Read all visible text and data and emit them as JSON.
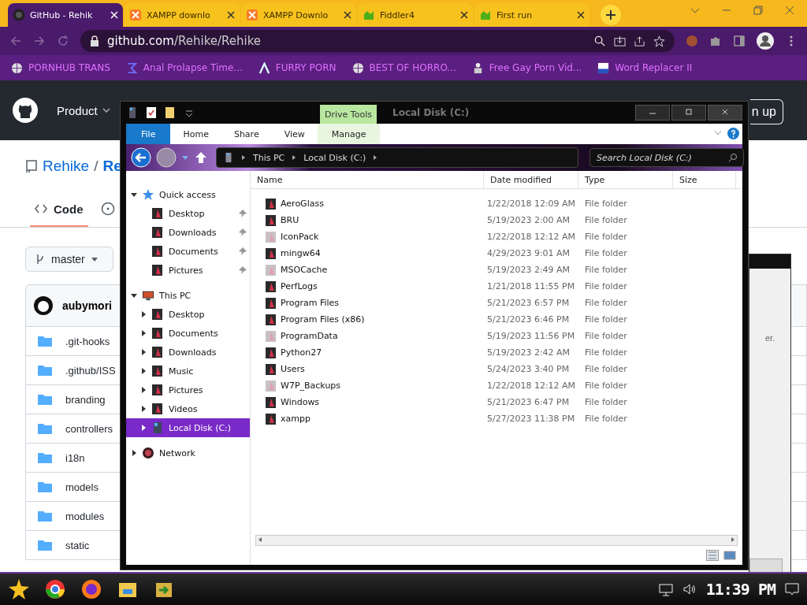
{
  "browser": {
    "tabs": [
      {
        "title": "GitHub - Rehik",
        "selected": true
      },
      {
        "title": "XAMPP downlo",
        "selected": false
      },
      {
        "title": "XAMPP Downlo",
        "selected": false
      },
      {
        "title": "Fiddler4",
        "selected": false
      },
      {
        "title": "First run",
        "selected": false
      }
    ],
    "address": {
      "host": "github.com",
      "path": "/Rehike/Rehike"
    },
    "bookmarks": [
      {
        "label": "PORNHUB TRANS"
      },
      {
        "label": "Anal Prolapse Time..."
      },
      {
        "label": "FURRY PORN"
      },
      {
        "label": "BEST OF HORRO..."
      },
      {
        "label": "Free Gay Porn Vid..."
      },
      {
        "label": "Word Replacer II"
      }
    ]
  },
  "github": {
    "nav_item": "Product",
    "header_button": "n up",
    "repo": {
      "owner": "Rehike",
      "separator": "/",
      "name": "Re"
    },
    "tabs": [
      {
        "label": "Code",
        "selected": true
      }
    ],
    "branch": "master",
    "commit_author": "aubymori",
    "files": [
      ".git-hooks",
      ".github/ISS",
      "branding",
      "controllers",
      "i18n",
      "models",
      "modules",
      "static"
    ]
  },
  "dialog_fragment": {
    "text": "er."
  },
  "explorer": {
    "title": "Local Disk (C:)",
    "contextual_group": "Drive Tools",
    "ribbon_tabs": [
      {
        "label": "File",
        "kind": "file"
      },
      {
        "label": "Home",
        "kind": "tab"
      },
      {
        "label": "Share",
        "kind": "tab"
      },
      {
        "label": "View",
        "kind": "tab"
      },
      {
        "label": "Manage",
        "kind": "contextual"
      }
    ],
    "breadcrumb": [
      "This PC",
      "Local Disk (C:)"
    ],
    "search": {
      "placeholder": "Search Local Disk (C:)"
    },
    "nav_tree": [
      {
        "label": "Quick access",
        "kind": "star",
        "expanded": true,
        "selected": false,
        "children": [
          {
            "label": "Desktop",
            "kind": "folder",
            "pinned": true,
            "selected": false
          },
          {
            "label": "Downloads",
            "kind": "folder",
            "pinned": true,
            "selected": false
          },
          {
            "label": "Documents",
            "kind": "folder",
            "pinned": true,
            "selected": false
          },
          {
            "label": "Pictures",
            "kind": "folder",
            "pinned": true,
            "selected": false
          }
        ]
      },
      {
        "label": "This PC",
        "kind": "pc",
        "expanded": true,
        "selected": false,
        "children": [
          {
            "label": "Desktop",
            "kind": "folder",
            "expanded": false,
            "selected": false
          },
          {
            "label": "Documents",
            "kind": "folder",
            "expanded": false,
            "selected": false
          },
          {
            "label": "Downloads",
            "kind": "folder",
            "expanded": false,
            "selected": false
          },
          {
            "label": "Music",
            "kind": "folder",
            "expanded": false,
            "selected": false
          },
          {
            "label": "Pictures",
            "kind": "folder",
            "expanded": false,
            "selected": false
          },
          {
            "label": "Videos",
            "kind": "folder",
            "expanded": false,
            "selected": false
          },
          {
            "label": "Local Disk (C:)",
            "kind": "disk",
            "expanded": false,
            "selected": true
          }
        ]
      },
      {
        "label": "Network",
        "kind": "network",
        "expanded": false,
        "selected": false
      }
    ],
    "columns": [
      "Name",
      "Date modified",
      "Type",
      "Size"
    ],
    "rows": [
      {
        "name": "AeroGlass",
        "date": "1/22/2018 12:09 AM",
        "type": "File folder",
        "hidden": false
      },
      {
        "name": "BRU",
        "date": "5/19/2023 2:00 AM",
        "type": "File folder",
        "hidden": false
      },
      {
        "name": "IconPack",
        "date": "1/22/2018 12:12 AM",
        "type": "File folder",
        "hidden": true
      },
      {
        "name": "mingw64",
        "date": "4/29/2023 9:01 AM",
        "type": "File folder",
        "hidden": false
      },
      {
        "name": "MSOCache",
        "date": "5/19/2023 2:49 AM",
        "type": "File folder",
        "hidden": true
      },
      {
        "name": "PerfLogs",
        "date": "1/21/2018 11:55 PM",
        "type": "File folder",
        "hidden": false
      },
      {
        "name": "Program Files",
        "date": "5/21/2023 6:57 PM",
        "type": "File folder",
        "hidden": false
      },
      {
        "name": "Program Files (x86)",
        "date": "5/21/2023 6:46 PM",
        "type": "File folder",
        "hidden": false
      },
      {
        "name": "ProgramData",
        "date": "5/19/2023 11:56 PM",
        "type": "File folder",
        "hidden": true
      },
      {
        "name": "Python27",
        "date": "5/19/2023 2:42 AM",
        "type": "File folder",
        "hidden": false
      },
      {
        "name": "Users",
        "date": "5/24/2023 3:40 PM",
        "type": "File folder",
        "hidden": false
      },
      {
        "name": "W7P_Backups",
        "date": "1/22/2018 12:12 AM",
        "type": "File folder",
        "hidden": true
      },
      {
        "name": "Windows",
        "date": "5/21/2023 6:47 PM",
        "type": "File folder",
        "hidden": false
      },
      {
        "name": "xampp",
        "date": "5/27/2023 11:38 PM",
        "type": "File folder",
        "hidden": false
      }
    ]
  },
  "taskbar": {
    "clock": "11:39 PM"
  }
}
